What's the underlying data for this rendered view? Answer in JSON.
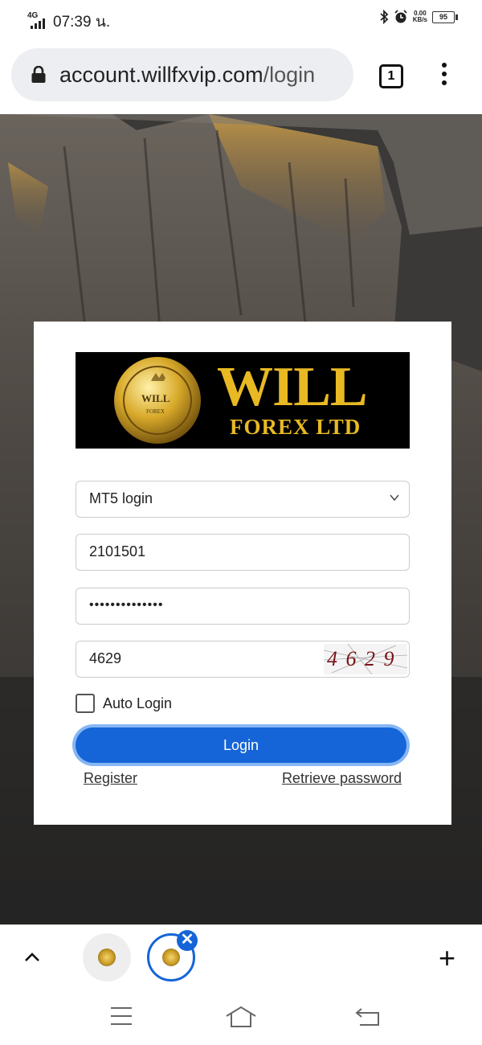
{
  "status_bar": {
    "network": "4G",
    "time": "07:39 น.",
    "speed_value": "0.00",
    "speed_unit": "KB/s",
    "battery": "95"
  },
  "browser": {
    "url_host": "account.willfxvip.com",
    "url_path": "/login",
    "tab_count": "1",
    "icons": [
      "lock-icon",
      "tab-switcher-icon",
      "more-menu-icon"
    ]
  },
  "logo": {
    "seal_top": "WILL",
    "seal_bottom": "FOREX",
    "brand_main": "WILL",
    "brand_sub": "FOREX LTD"
  },
  "login_form": {
    "account_type": "MT5 login",
    "login_id": "2101501",
    "password_masked": "••••••••••••••",
    "captcha_value": "4629",
    "captcha_image_text": "4 6 2 9",
    "auto_login_label": "Auto Login",
    "auto_login_checked": false,
    "submit_label": "Login",
    "register_link": "Register",
    "retrieve_link": "Retrieve password"
  },
  "colors": {
    "primary": "#1565d8",
    "primary_glow": "#86b7f4",
    "logo_gold": "#e8b923"
  },
  "bottom_tabs": {
    "close_glyph": "✕",
    "new_tab_glyph": "+"
  }
}
